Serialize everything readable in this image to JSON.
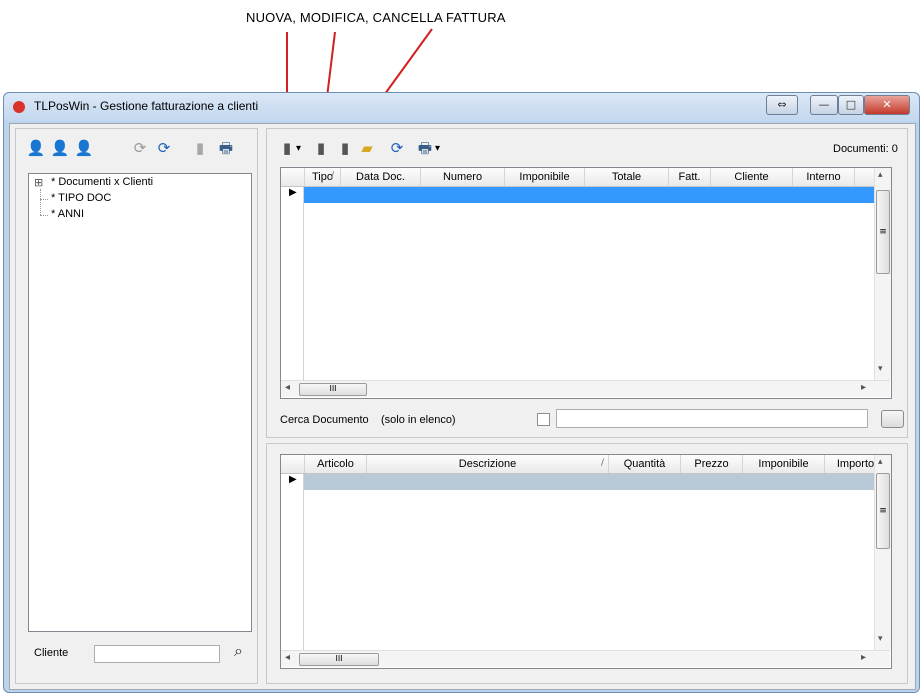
{
  "annotation": {
    "text": "NUOVA, MODIFICA, CANCELLA FATTURA"
  },
  "window": {
    "title": "TLPosWin - Gestione fatturazione a clienti"
  },
  "titlebar_buttons": {
    "restore": "⇔",
    "minimize": "—",
    "maximize": "□",
    "close": "✕"
  },
  "left_toolbar": {
    "icons": [
      "add-client-icon",
      "edit-client-icon",
      "delete-client-icon",
      "sync-icon",
      "refresh-icon",
      "disabled-device-icon",
      "print-icon"
    ],
    "glyphs": [
      "👤",
      "👤",
      "👤",
      "⟳",
      "⟳",
      "▮",
      "🖶"
    ]
  },
  "tree": {
    "items": [
      "* Documenti x Clienti",
      "* TIPO DOC",
      "* ANNI"
    ],
    "expander": "⊞"
  },
  "left_bottom": {
    "cliente_label": "Cliente",
    "cliente_value": "",
    "binoculars_glyph": "⌕"
  },
  "right_toolbar": {
    "documenti_count": "Documenti: 0",
    "dropdown_glyph": "▾",
    "glyphs": [
      "▮",
      "▮",
      "▮",
      "▰",
      "⟳",
      "🖶"
    ]
  },
  "documents_table": {
    "columns": [
      "Tipo",
      "Data Doc.",
      "Numero",
      "Imponibile",
      "Totale",
      "Fatt.",
      "Cliente",
      "Interno"
    ],
    "row_indicator": "▶",
    "sort_glyph": "/"
  },
  "search": {
    "label": "Cerca Documento",
    "hint": "(solo in elenco)",
    "value": ""
  },
  "lines_table": {
    "columns": [
      "Articolo",
      "Descrizione",
      "Quantità",
      "Prezzo",
      "Imponibile",
      "Importo"
    ],
    "row_indicator": "▶",
    "sort_glyph": "/"
  },
  "scroll": {
    "left": "◂",
    "right": "▸",
    "up": "▴",
    "down": "▾",
    "grip": "III",
    "vgrip": "≡"
  },
  "colors": {
    "selection": "#3399ff",
    "selection_inactive": "#b9c9d8",
    "annotation_arrow": "#d31f1f"
  }
}
